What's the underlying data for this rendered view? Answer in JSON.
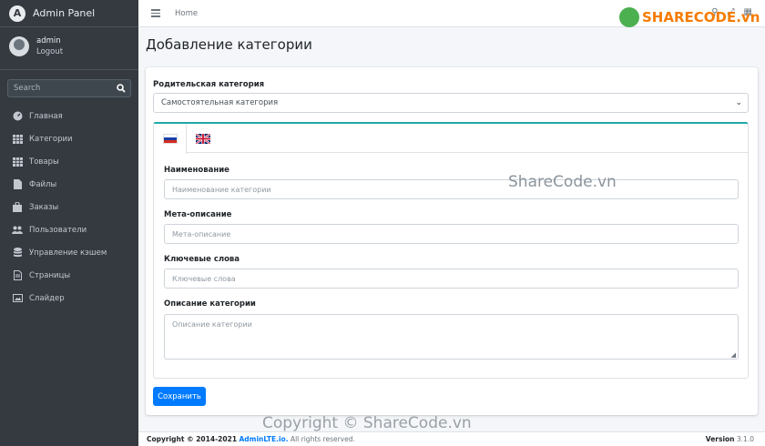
{
  "brand": {
    "logo_letter": "A",
    "title": "Admin Panel"
  },
  "user": {
    "name": "admin",
    "logout": "Logout"
  },
  "search": {
    "placeholder": "Search"
  },
  "nav": [
    {
      "icon": "tachometer-icon",
      "label": "Главная"
    },
    {
      "icon": "grid-icon",
      "label": "Категории"
    },
    {
      "icon": "grid-icon",
      "label": "Товары"
    },
    {
      "icon": "file-icon",
      "label": "Файлы"
    },
    {
      "icon": "bag-icon",
      "label": "Заказы"
    },
    {
      "icon": "users-icon",
      "label": "Пользователи"
    },
    {
      "icon": "database-icon",
      "label": "Управление кэшем"
    },
    {
      "icon": "page-icon",
      "label": "Страницы"
    },
    {
      "icon": "image-icon",
      "label": "Слайдер"
    }
  ],
  "topbar": {
    "home": "Home"
  },
  "page": {
    "title": "Добавление категории"
  },
  "form": {
    "parent_label": "Родительская категория",
    "parent_value": "Самостоятельная категория",
    "tabs": [
      {
        "icon": "flag-ru-icon"
      },
      {
        "icon": "flag-uk-icon"
      }
    ],
    "name_label": "Наименование",
    "name_placeholder": "Наименование категории",
    "meta_label": "Мета-описание",
    "meta_placeholder": "Мета-описание",
    "keywords_label": "Ключевые слова",
    "keywords_placeholder": "Ключевые слова",
    "desc_label": "Описание категории",
    "desc_placeholder": "Описание категории",
    "save": "Сохранить"
  },
  "footer": {
    "copyright_prefix": "Copyright © 2014-2021 ",
    "link": "AdminLTE.io.",
    "suffix": " All rights reserved.",
    "version_label": "Version",
    "version": "3.1.0"
  },
  "watermarks": {
    "logo": "SHARECODE.vn",
    "center": "ShareCode.vn",
    "bottom": "Copyright © ShareCode.vn"
  },
  "colors": {
    "sidebar": "#343a40",
    "accent": "#007bff",
    "tab_border": "#20a8a8"
  }
}
